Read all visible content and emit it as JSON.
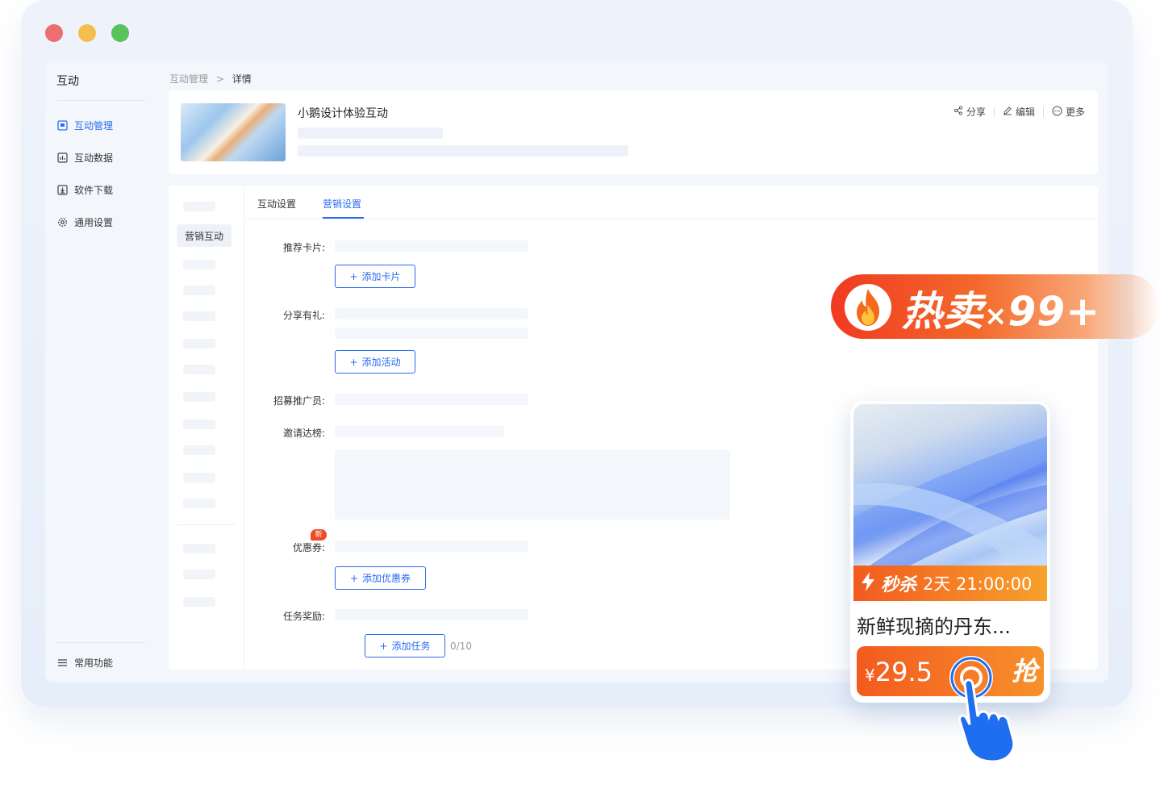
{
  "sidebar": {
    "title": "互动",
    "items": [
      {
        "label": "互动管理",
        "icon": "dashboard-icon",
        "active": true
      },
      {
        "label": "互动数据",
        "icon": "data-chart-icon",
        "active": false
      },
      {
        "label": "软件下载",
        "icon": "download-icon",
        "active": false
      },
      {
        "label": "通用设置",
        "icon": "gear-icon",
        "active": false
      }
    ],
    "footer_item": {
      "label": "常用功能",
      "icon": "list-icon"
    }
  },
  "breadcrumb": {
    "parent": "互动管理",
    "separator": ">",
    "current": "详情"
  },
  "header": {
    "title": "小鹅设计体验互动",
    "actions": [
      {
        "label": "分享",
        "icon": "share-icon"
      },
      {
        "label": "编辑",
        "icon": "edit-icon"
      },
      {
        "label": "更多",
        "icon": "more-icon"
      }
    ]
  },
  "subnav": {
    "active_label": "营销互动"
  },
  "tabs": [
    {
      "label": "互动设置",
      "active": false
    },
    {
      "label": "营销设置",
      "active": true
    }
  ],
  "form": {
    "recommend_card": {
      "label": "推荐卡片:",
      "button": "添加卡片"
    },
    "share_gift": {
      "label": "分享有礼:",
      "button": "添加活动"
    },
    "recruit": {
      "label": "招募推广员:"
    },
    "invite_rank": {
      "label": "邀请达榜:"
    },
    "coupon": {
      "label": "优惠券:",
      "badge": "新",
      "button": "添加优惠券"
    },
    "task_reward": {
      "label": "任务奖励:",
      "button": "添加任务",
      "counter": "0/10"
    }
  },
  "promo": {
    "hot_label": "热卖",
    "hot_multiplier": "×",
    "hot_count": "99+",
    "flash_sale_label": "秒杀",
    "countdown": "2天 21:00:00",
    "product_name": "新鲜现摘的丹东...",
    "price_symbol": "¥",
    "price": "29.5",
    "grab_label": "抢"
  },
  "colors": {
    "accent": "#2a6cf0",
    "promo_orange": "#f35a1f",
    "badge_red": "#f04a23"
  }
}
